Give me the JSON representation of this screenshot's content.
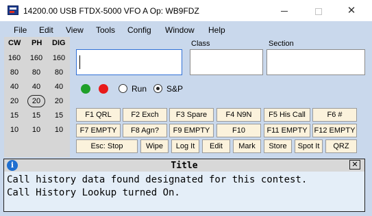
{
  "window": {
    "title": "14200.00 USB FTDX-5000 VFO A    Op: WB9FDZ",
    "minimize": "",
    "maximize": "",
    "close": "✕"
  },
  "menu": [
    "File",
    "Edit",
    "View",
    "Tools",
    "Config",
    "Window",
    "Help"
  ],
  "bands": {
    "headers": [
      "CW",
      "PH",
      "DIG"
    ],
    "rows": [
      [
        "160",
        "160",
        "160"
      ],
      [
        "80",
        "80",
        "80"
      ],
      [
        "40",
        "40",
        "40"
      ],
      [
        "20",
        "20",
        "20"
      ],
      [
        "15",
        "15",
        "15"
      ],
      [
        "10",
        "10",
        "10"
      ]
    ],
    "selected": "PH 20"
  },
  "fields": {
    "callsign": {
      "value": ""
    },
    "class": {
      "label": "Class",
      "value": ""
    },
    "section": {
      "label": "Section",
      "value": ""
    }
  },
  "mode": {
    "run_label": "Run",
    "sp_label": "S&P",
    "selected": "S&P"
  },
  "function_keys": {
    "row1": [
      "F1 QRL",
      "F2 Exch",
      "F3 Spare",
      "F4 N9N",
      "F5 His Call",
      "F6 #"
    ],
    "row2": [
      "F7 EMPTY",
      "F8 Agn?",
      "F9 EMPTY",
      "F10",
      "F11 EMPTY",
      "F12 EMPTY"
    ],
    "row3": [
      "Esc: Stop",
      "Wipe",
      "Log It",
      "Edit",
      "Mark",
      "Store",
      "Spot It",
      "QRZ"
    ]
  },
  "info": {
    "icon": "i",
    "title": "Title",
    "close": "✕",
    "lines": [
      "Call history data found designated for this contest.",
      "Call History Lookup turned On."
    ]
  },
  "colors": {
    "client_bg": "#c9d8ec",
    "band_panel_bg": "#d6d6d6",
    "button_bg": "#fbf2dc",
    "info_bg": "#e4eef8",
    "status_green": "#1fa02a",
    "status_red": "#e81a1a"
  }
}
